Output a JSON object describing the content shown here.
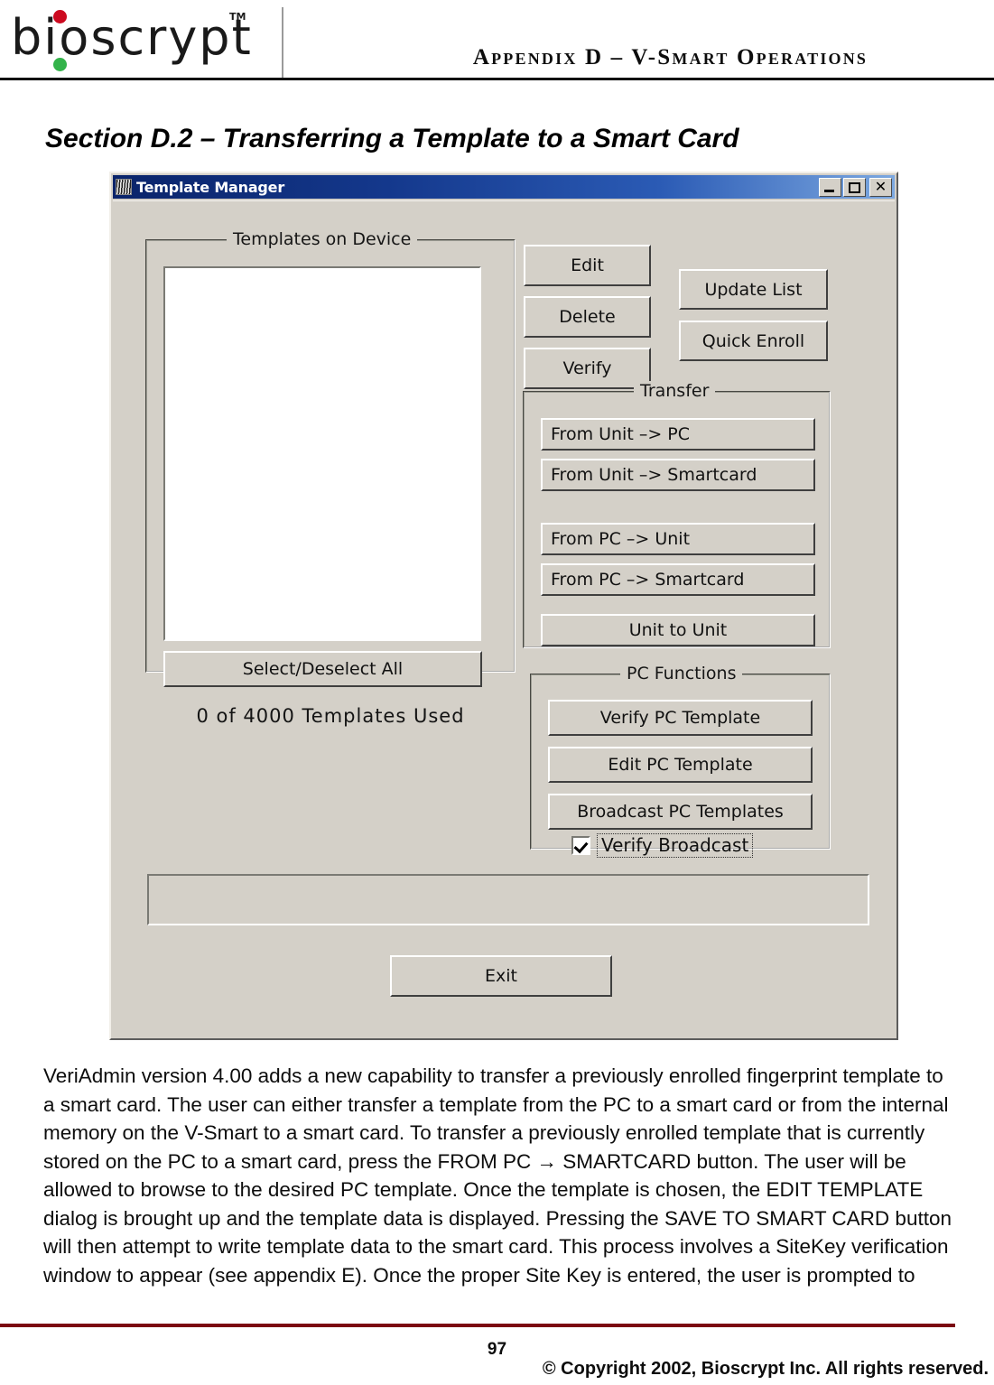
{
  "page_header": {
    "logo_text": "bioscrypt",
    "logo_tm": "TM",
    "logo_dot_top_color": "#cc0a20",
    "logo_dot_bottom_color": "#33b34a",
    "appendix_title": "Appendix D – V-Smart Operations"
  },
  "section": {
    "heading": "Section D.2 – Transferring a Template to a Smart Card"
  },
  "dialog": {
    "title": "Template Manager",
    "titlebar_buttons": {
      "minimize": "Minimize",
      "maximize": "Maximize",
      "close": "Close"
    },
    "groups": {
      "templates_on_device": {
        "legend": "Templates on Device",
        "list_items": [],
        "select_deselect_all": "Select/Deselect All"
      },
      "transfer": {
        "legend": "Transfer",
        "buttons": [
          "From Unit –> PC",
          "From Unit –> Smartcard",
          "From PC  –> Unit",
          "From PC  –> Smartcard",
          "Unit to Unit"
        ]
      },
      "pc_functions": {
        "legend": "PC Functions",
        "buttons": [
          "Verify PC Template",
          "Edit PC Template",
          "Broadcast PC Templates"
        ],
        "verify_broadcast_label": "Verify Broadcast",
        "verify_broadcast_checked": true
      }
    },
    "action_buttons": {
      "edit": "Edit",
      "delete": "Delete",
      "verify": "Verify",
      "update_list": "Update List",
      "quick_enroll": "Quick Enroll",
      "exit": "Exit"
    },
    "templates_used": "0  of  4000  Templates Used",
    "status_text": ""
  },
  "body": {
    "paragraph": "VeriAdmin version 4.00 adds a new capability to transfer a previously enrolled fingerprint template to a smart card.  The user can either transfer a template from the PC to a smart card or from the internal memory on the V-Smart to a smart card.  To transfer a previously enrolled template that is currently stored on the PC to a smart card, press the FROM PC → SMARTCARD button.  The user will be allowed to browse to the desired PC template.  Once the template is chosen, the EDIT TEMPLATE dialog is brought up and the template data is displayed.  Pressing the SAVE TO SMART CARD button will then attempt to write template data to the smart card.  This process involves a SiteKey verification window to appear (see appendix E).  Once the proper Site Key is entered, the user is prompted to"
  },
  "footer": {
    "rule_color": "#7b0712",
    "page_number": "97",
    "copyright": "© Copyright 2002, Bioscrypt Inc.  All rights reserved."
  }
}
